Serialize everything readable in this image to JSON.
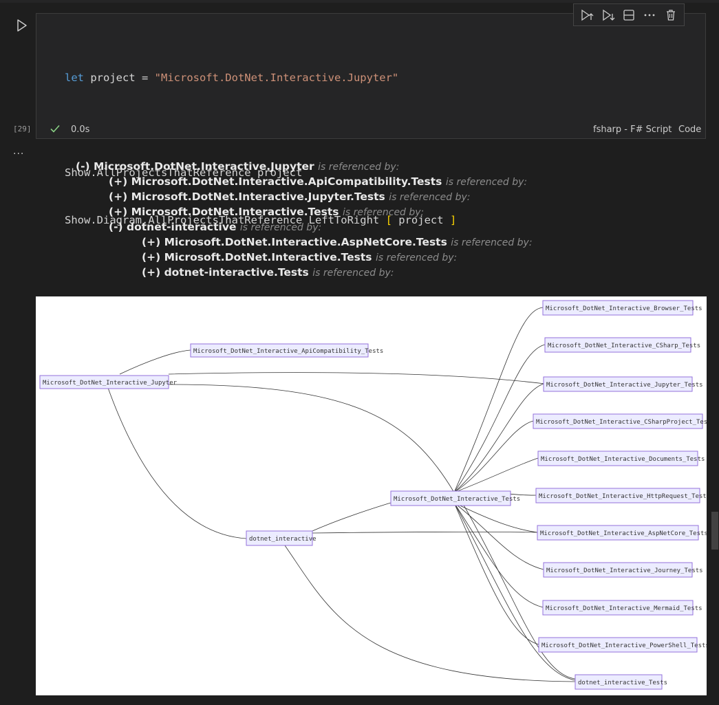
{
  "cell": {
    "execution_count": "[29]",
    "status_time": "0.0s",
    "language_label": "fsharp - F# Script",
    "mode_label": "Code",
    "code": {
      "line1": {
        "kw": "let",
        "mid": " project = ",
        "str": "\"Microsoft.DotNet.Interactive.Jupyter\""
      },
      "line3": "Show.AllProjectsThatReference project",
      "line4": {
        "pre": "Show.Diagram.AllProjectsThatReference LeftToRight ",
        "open": "[",
        "mid": " project ",
        "close": "]"
      }
    },
    "toolbar": {
      "icons": [
        "execute-above-icon",
        "execute-below-icon",
        "split-cell-icon",
        "more-actions-icon",
        "delete-icon"
      ]
    }
  },
  "output": {
    "more_label": "...",
    "tree": [
      {
        "marker": "(-)",
        "name": "Microsoft.DotNet.Interactive.Jupyter",
        "suffix": "is referenced by:"
      },
      {
        "marker": "(+)",
        "name": "Microsoft.DotNet.Interactive.ApiCompatibility.Tests",
        "suffix": "is referenced by:"
      },
      {
        "marker": "(+)",
        "name": "Microsoft.DotNet.Interactive.Jupyter.Tests",
        "suffix": "is referenced by:"
      },
      {
        "marker": "(+)",
        "name": "Microsoft.DotNet.Interactive.Tests",
        "suffix": "is referenced by:"
      },
      {
        "marker": "(-)",
        "name": "dotnet-interactive",
        "suffix": "is referenced by:"
      },
      {
        "marker": "(+)",
        "name": "Microsoft.DotNet.Interactive.AspNetCore.Tests",
        "suffix": "is referenced by:"
      },
      {
        "marker": "(+)",
        "name": "Microsoft.DotNet.Interactive.Tests",
        "suffix": "is referenced by:"
      },
      {
        "marker": "(+)",
        "name": "dotnet-interactive.Tests",
        "suffix": "is referenced by:"
      }
    ]
  },
  "diagram": {
    "direction": "LeftToRight",
    "nodes": [
      {
        "id": "jupyter",
        "label": "Microsoft_DotNet_Interactive_Jupyter"
      },
      {
        "id": "apicompat",
        "label": "Microsoft_DotNet_Interactive_ApiCompatibility_Tests"
      },
      {
        "id": "dotnet",
        "label": "dotnet_interactive"
      },
      {
        "id": "tests",
        "label": "Microsoft_DotNet_Interactive_Tests"
      },
      {
        "id": "browser",
        "label": "Microsoft_DotNet_Interactive_Browser_Tests"
      },
      {
        "id": "csharp",
        "label": "Microsoft_DotNet_Interactive_CSharp_Tests"
      },
      {
        "id": "jupytertests",
        "label": "Microsoft_DotNet_Interactive_Jupyter_Tests"
      },
      {
        "id": "csproj",
        "label": "Microsoft_DotNet_Interactive_CSharpProject_Tests"
      },
      {
        "id": "documents",
        "label": "Microsoft_DotNet_Interactive_Documents_Tests"
      },
      {
        "id": "http",
        "label": "Microsoft_DotNet_Interactive_HttpRequest_Tests"
      },
      {
        "id": "aspnet",
        "label": "Microsoft_DotNet_Interactive_AspNetCore_Tests"
      },
      {
        "id": "journey",
        "label": "Microsoft_DotNet_Interactive_Journey_Tests"
      },
      {
        "id": "mermaid",
        "label": "Microsoft_DotNet_Interactive_Mermaid_Tests"
      },
      {
        "id": "powershell",
        "label": "Microsoft_DotNet_Interactive_PowerShell_Tests"
      },
      {
        "id": "dntests",
        "label": "dotnet_interactive_Tests"
      }
    ]
  }
}
